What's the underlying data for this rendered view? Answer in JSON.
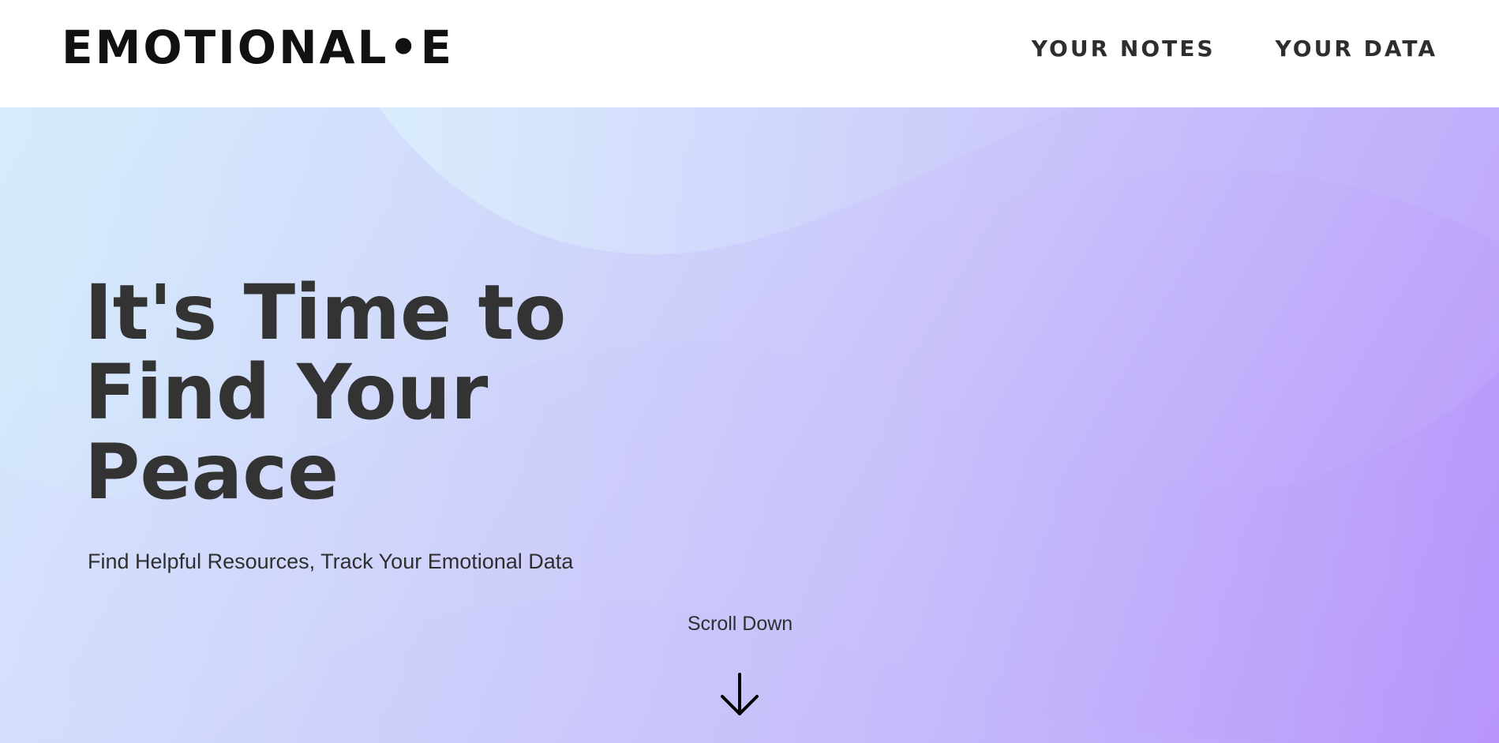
{
  "header": {
    "logo_text": "EMOTIONAL•E",
    "nav": [
      {
        "label": "YOUR NOTES"
      },
      {
        "label": "YOUR DATA"
      }
    ]
  },
  "hero": {
    "headline": "It's Time to Find Your Peace",
    "subtitle": "Find Helpful Resources, Track Your Emotional Data",
    "scroll_label": "Scroll Down",
    "scroll_icon": "arrow-down-icon"
  },
  "colors": {
    "text_dark": "#333333",
    "gradient_start": "#d6eefc",
    "gradient_mid": "#cac5fb",
    "gradient_end": "#b897fb"
  }
}
